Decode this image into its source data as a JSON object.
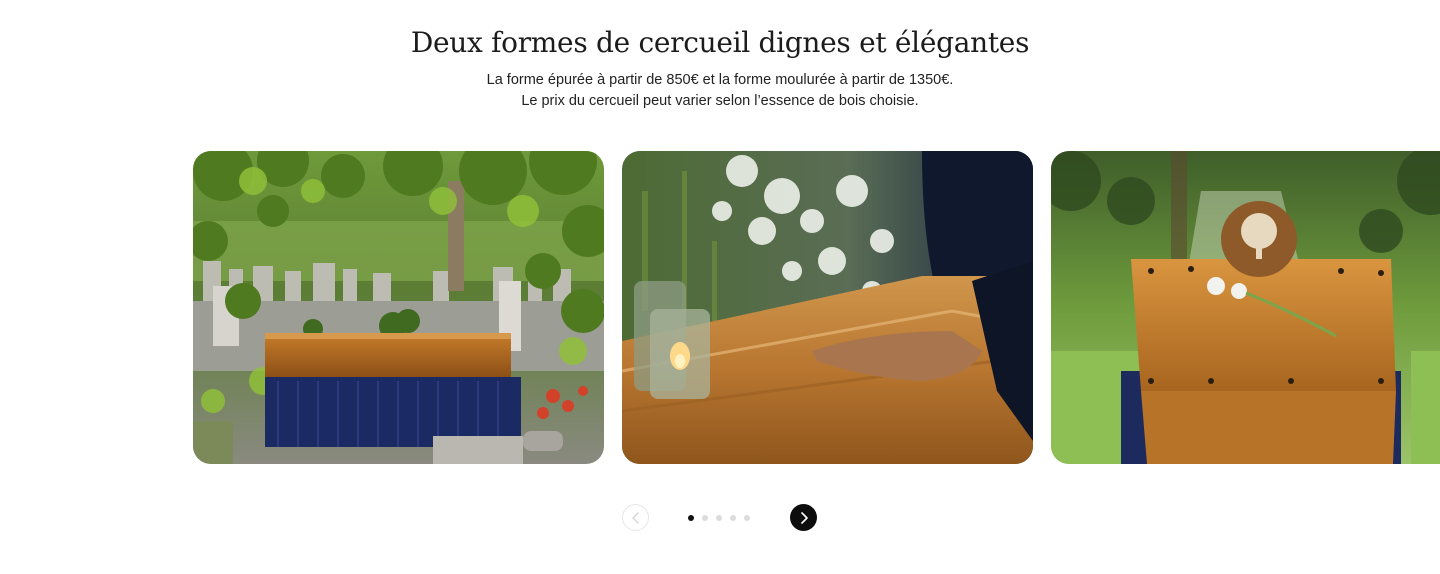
{
  "section": {
    "title": "Deux formes de cercueil dignes et élégantes",
    "subtitle_line1": "La forme épurée à partir de 850€ et la forme moulurée à partir de 1350€.",
    "subtitle_line2": "Le prix du cercueil peut varier selon l’essence de bois choisie."
  },
  "carousel": {
    "slides": [
      {
        "image": "coffin-in-cemetery-under-vines"
      },
      {
        "image": "hand-on-wooden-coffin-with-candles"
      },
      {
        "image": "coffin-with-tree-emblem-and-flower"
      }
    ],
    "prev_icon": "chevron-left-icon",
    "next_icon": "chevron-right-icon",
    "dot_count": 5,
    "active_dot": 1
  }
}
